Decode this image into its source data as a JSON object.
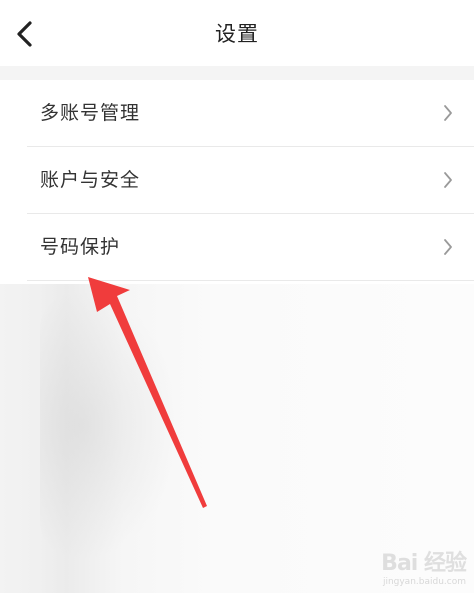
{
  "header": {
    "title": "设置",
    "back_icon": "chevron-left-icon"
  },
  "settings": {
    "items": [
      {
        "label": "多账号管理",
        "icon": "chevron-right-icon"
      },
      {
        "label": "账户与安全",
        "icon": "chevron-right-icon"
      },
      {
        "label": "号码保护",
        "icon": "chevron-right-icon"
      }
    ]
  },
  "annotation": {
    "type": "red-arrow",
    "color": "#f03c3c",
    "points_to": "号码保护"
  },
  "watermark": {
    "text": "Bai 经验",
    "sub": "jingyan.baidu.com"
  },
  "colors": {
    "background": "#ffffff",
    "section_gap": "#f4f4f4",
    "divider": "#e9e9e9",
    "text": "#333333",
    "chevron": "#9a9a9a"
  }
}
